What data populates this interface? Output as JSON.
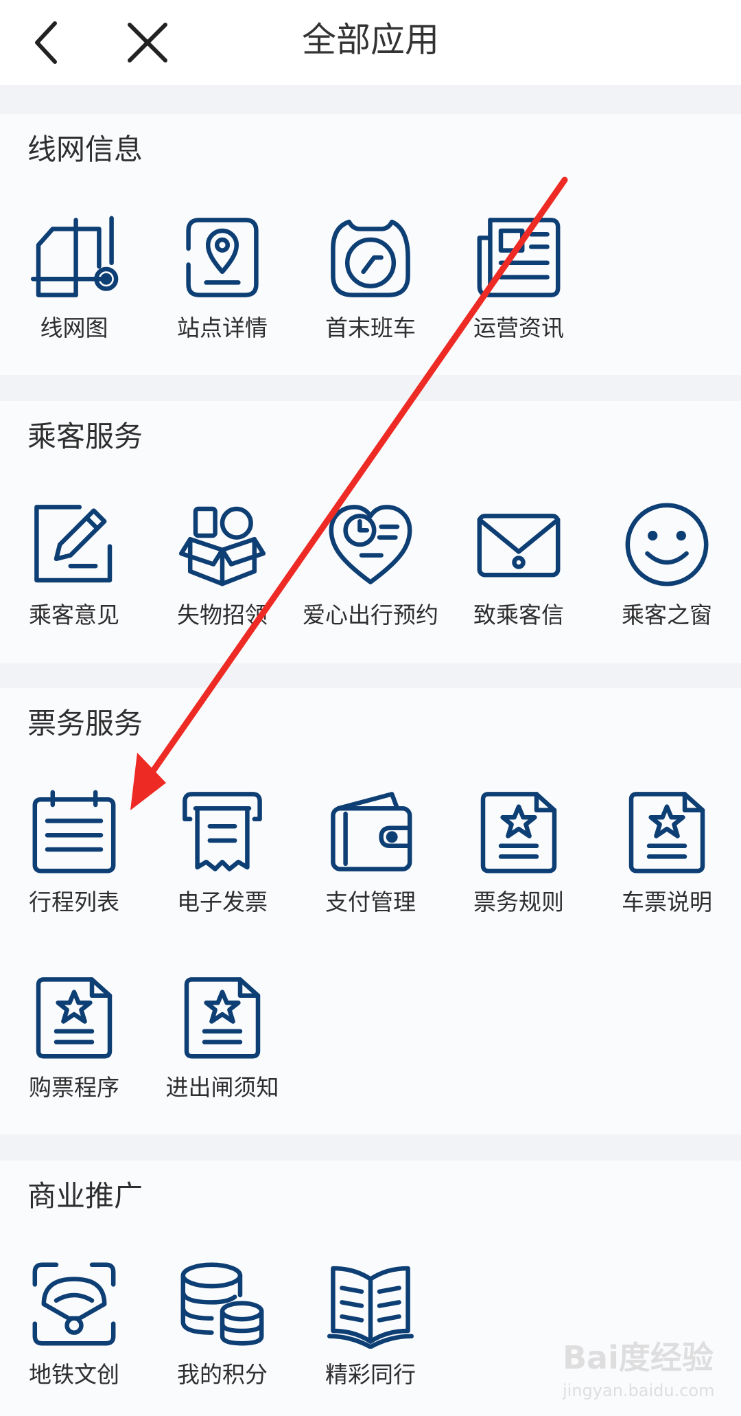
{
  "header": {
    "title": "全部应用",
    "back_icon": "chevron-left-icon",
    "close_icon": "close-icon"
  },
  "theme": {
    "icon_color": "#0e3f74",
    "arrow_color": "#ee2a24"
  },
  "sections": [
    {
      "title": "线网信息",
      "items": [
        {
          "label": "线网图",
          "icon": "network-map-icon"
        },
        {
          "label": "站点详情",
          "icon": "station-pin-icon"
        },
        {
          "label": "首末班车",
          "icon": "clock-icon"
        },
        {
          "label": "运营资讯",
          "icon": "newspaper-icon"
        }
      ]
    },
    {
      "title": "乘客服务",
      "items": [
        {
          "label": "乘客意见",
          "icon": "edit-pencil-icon"
        },
        {
          "label": "失物招领",
          "icon": "box-icon"
        },
        {
          "label": "爱心出行预约",
          "icon": "heart-clock-icon"
        },
        {
          "label": "致乘客信",
          "icon": "envelope-icon"
        },
        {
          "label": "乘客之窗",
          "icon": "smiley-icon"
        }
      ]
    },
    {
      "title": "票务服务",
      "items": [
        {
          "label": "行程列表",
          "icon": "calendar-list-icon"
        },
        {
          "label": "电子发票",
          "icon": "receipt-icon"
        },
        {
          "label": "支付管理",
          "icon": "wallet-icon"
        },
        {
          "label": "票务规则",
          "icon": "star-document-icon"
        },
        {
          "label": "车票说明",
          "icon": "star-document-icon"
        },
        {
          "label": "购票程序",
          "icon": "star-document-icon"
        },
        {
          "label": "进出闸须知",
          "icon": "star-document-icon"
        }
      ]
    },
    {
      "title": "商业推广",
      "items": [
        {
          "label": "地铁文创",
          "icon": "fan-icon"
        },
        {
          "label": "我的积分",
          "icon": "coins-icon"
        },
        {
          "label": "精彩同行",
          "icon": "open-book-icon"
        }
      ]
    }
  ],
  "watermark": {
    "main": "Bai度经验",
    "sub": "jingyan.baidu.com"
  }
}
